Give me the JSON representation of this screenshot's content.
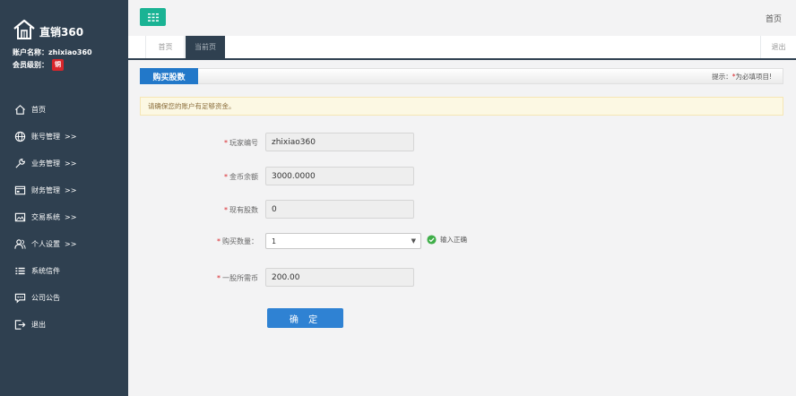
{
  "brand": {
    "name": "直销360"
  },
  "user": {
    "account_label": "账户名称：",
    "account_value": "zhixiao360",
    "level_label": "会员级别：",
    "level_badge": "铜"
  },
  "sidebar": {
    "items": [
      {
        "label": "首页",
        "arrow": "",
        "icon": "home-icon"
      },
      {
        "label": "账号管理",
        "arrow": ">>",
        "icon": "globe-icon"
      },
      {
        "label": "业务管理",
        "arrow": ">>",
        "icon": "wrench-icon"
      },
      {
        "label": "财务管理",
        "arrow": ">>",
        "icon": "wallet-icon"
      },
      {
        "label": "交易系统",
        "arrow": ">>",
        "icon": "picture-icon"
      },
      {
        "label": "个人设置",
        "arrow": ">>",
        "icon": "users-icon"
      },
      {
        "label": "系统信件",
        "arrow": "",
        "icon": "list-icon"
      },
      {
        "label": "公司公告",
        "arrow": "",
        "icon": "comment-icon"
      },
      {
        "label": "退出",
        "arrow": "",
        "icon": "sign-out-icon"
      }
    ]
  },
  "topbar": {
    "home_link": "首页"
  },
  "tabs": {
    "home": "首页",
    "current": "当前页",
    "logout": "退出"
  },
  "panel": {
    "title": "购买股数",
    "hint_prefix": "提示：",
    "hint_star": "*",
    "hint_suffix": "为必填项目!"
  },
  "warning": "请确保您的账户有足够资金。",
  "form": {
    "player_id": {
      "label": "玩家编号",
      "value": "zhixiao360"
    },
    "balance": {
      "label": "金币余额",
      "value": "3000.0000"
    },
    "shares": {
      "label": "现有股数",
      "value": "0"
    },
    "quantity": {
      "label": "购买数量：",
      "value": "1",
      "valid_msg": "输入正确"
    },
    "price": {
      "label": "一股所需币",
      "value": "200.00"
    },
    "required_mark": "*",
    "submit": "确 定"
  },
  "colors": {
    "sidebar_bg": "#2f4050",
    "accent_green": "#1ab394",
    "primary_blue": "#2f82d3",
    "warning_bg": "#fcf8e3",
    "required_red": "#d9262b"
  }
}
